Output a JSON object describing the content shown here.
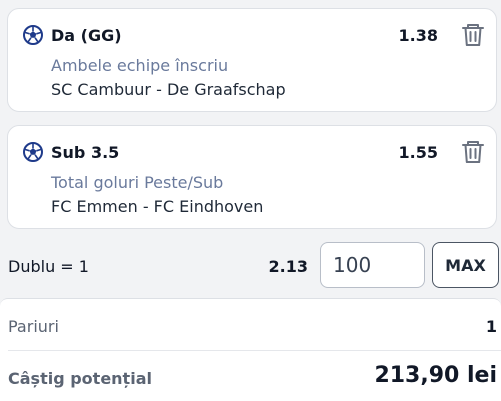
{
  "selections": [
    {
      "pick": "Da (GG)",
      "odds": "1.38",
      "market": "Ambele echipe înscriu",
      "match": "SC Cambuur - De Graafschap",
      "icon": "soccer-ball-icon",
      "remove_icon": "trash-icon"
    },
    {
      "pick": "Sub 3.5",
      "odds": "1.55",
      "market": "Total goluri Peste/Sub",
      "match": "FC Emmen - FC Eindhoven",
      "icon": "soccer-ball-icon",
      "remove_icon": "trash-icon"
    }
  ],
  "stake": {
    "type_label": "Dublu = 1",
    "total_odds": "2.13",
    "amount": "100",
    "max_label": "MAX"
  },
  "summary": {
    "bets_label": "Pariuri",
    "bets_count": "1",
    "potential_win_label": "Câștig potențial",
    "potential_win_value": "213,90 lei"
  },
  "colors": {
    "ball_blue": "#1e3a8a",
    "market_text": "#6a7a9c",
    "background": "#f2f3f5"
  }
}
